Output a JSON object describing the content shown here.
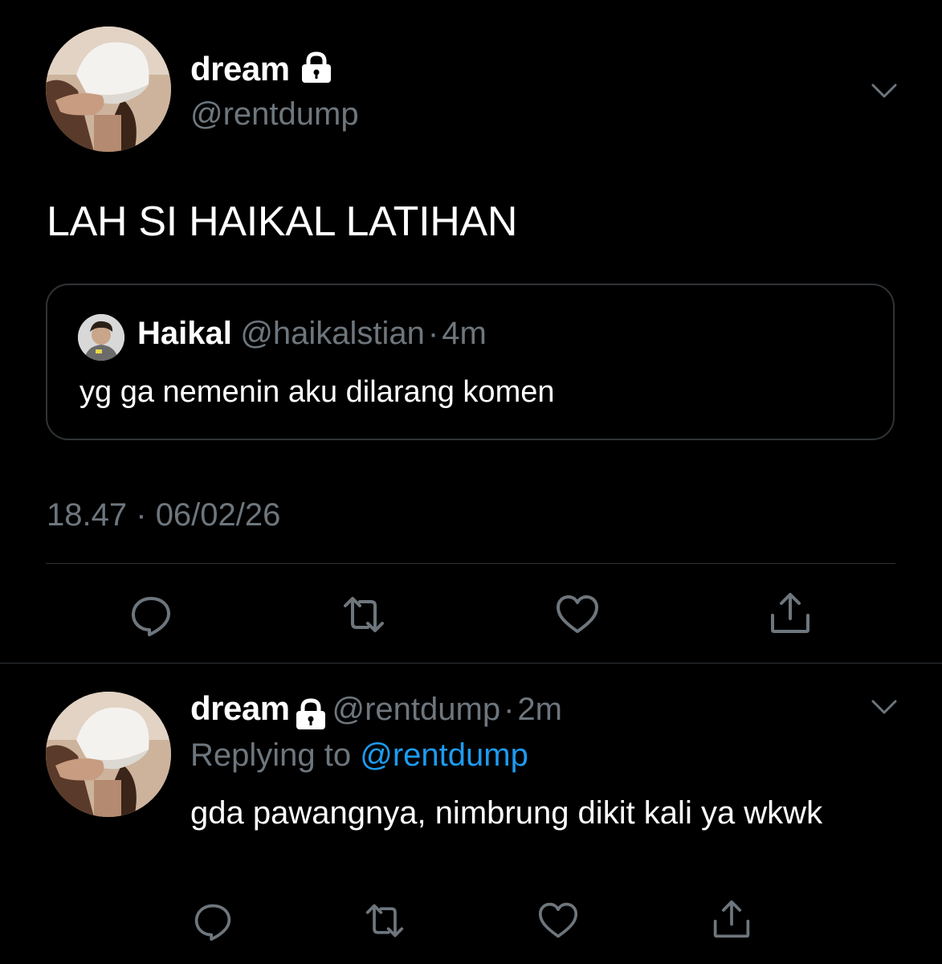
{
  "colors": {
    "background": "#000000",
    "text_primary": "#ffffff",
    "text_secondary": "#6e767d",
    "accent": "#1d9bf0",
    "border": "#2f3336"
  },
  "main_tweet": {
    "display_name": "dream",
    "handle": "@rentdump",
    "text": "LAH SI HAIKAL LATIHAN",
    "quote": {
      "display_name": "Haikal",
      "handle": "@haikalstian",
      "separator": "·",
      "age": "4m",
      "text": "yg ga nemenin aku dilarang komen"
    },
    "time": "18.47",
    "date_separator": "·",
    "date": "06/02/26",
    "icons": {
      "lock": "lock-icon",
      "menu": "chevron-down-icon",
      "reply": "reply-icon",
      "retweet": "retweet-icon",
      "like": "heart-icon",
      "share": "share-icon"
    }
  },
  "reply_tweet": {
    "display_name": "dream",
    "handle": "@rentdump",
    "separator": "·",
    "age": "2m",
    "replying_label": "Replying to",
    "replying_to": "@rentdump",
    "text": "gda pawangnya, nimbrung dikit kali ya wkwk"
  }
}
